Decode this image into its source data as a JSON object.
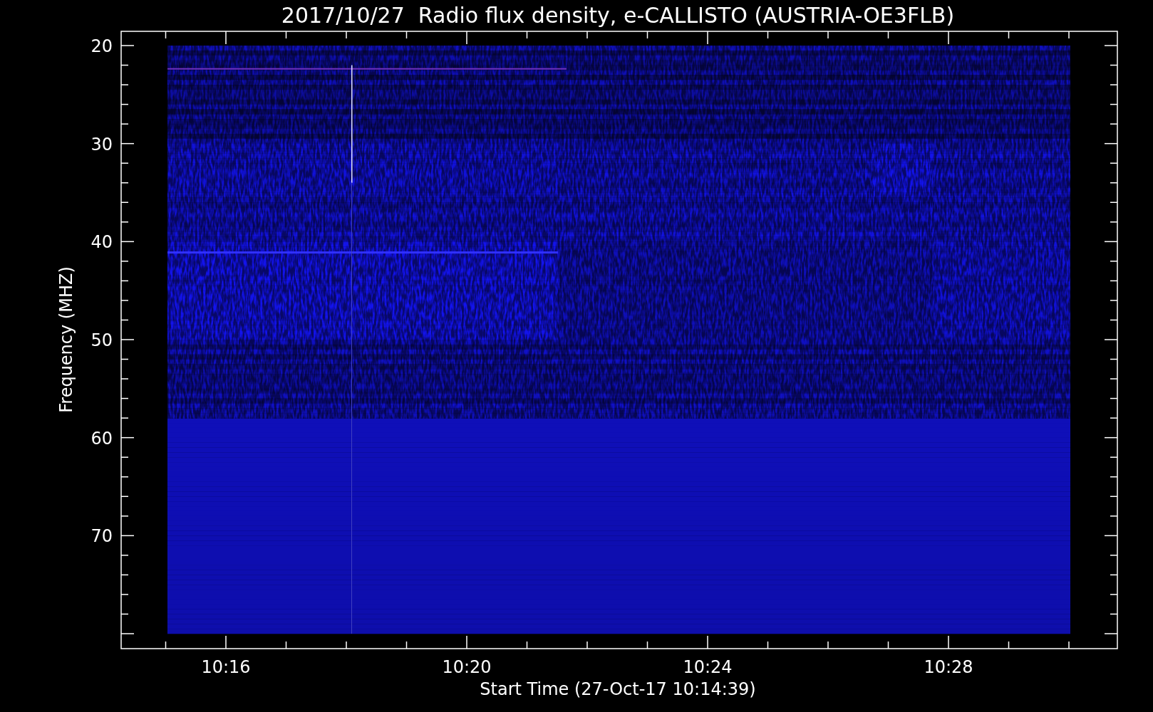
{
  "title": "2017/10/27  Radio flux density, e-CALLISTO (AUSTRIA-OE3FLB)",
  "y_axis": {
    "label": "Frequency (MHZ)",
    "ticks": [
      "20",
      "30",
      "40",
      "50",
      "60",
      "70"
    ]
  },
  "x_axis": {
    "label": "Start Time (27-Oct-17 10:14:39)",
    "ticks": [
      "10:16",
      "10:20",
      "10:24",
      "10:28"
    ]
  }
}
